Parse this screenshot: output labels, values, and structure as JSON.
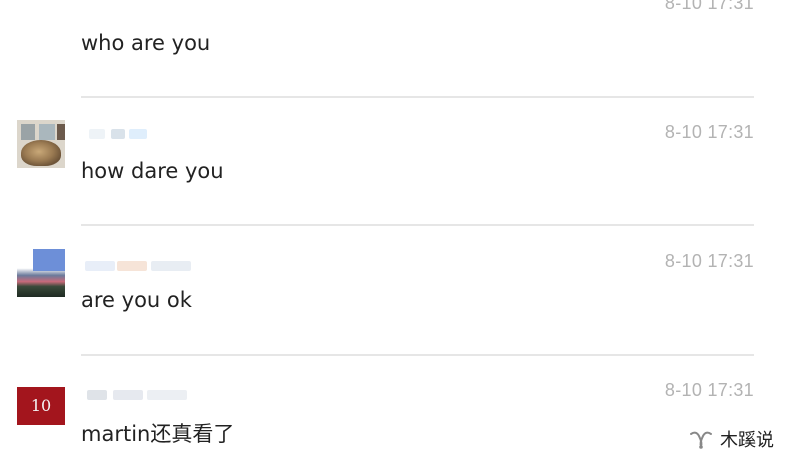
{
  "comments": [
    {
      "time": "8-10 17:31",
      "text": "who are you"
    },
    {
      "time": "8-10 17:31",
      "text": "how dare you"
    },
    {
      "time": "8-10 17:31",
      "text": "are you ok"
    },
    {
      "time": "8-10 17:31",
      "text": "martin还真看了",
      "avatar_label": "10"
    }
  ],
  "watermark": {
    "text": "木蹊说",
    "icon": "wechat-channel-icon"
  }
}
